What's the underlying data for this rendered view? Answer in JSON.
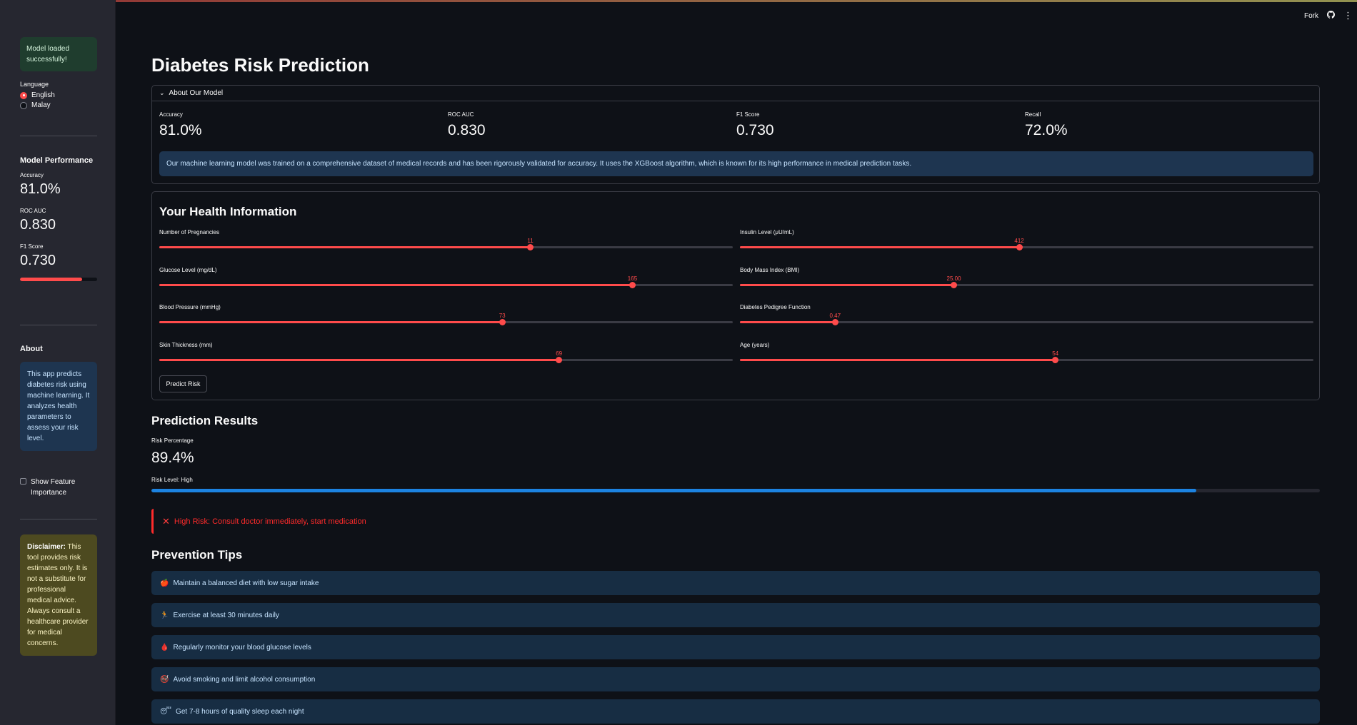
{
  "topbar": {
    "fork_label": "Fork",
    "github_icon": "github-icon",
    "menu_icon": "kebab-menu-icon"
  },
  "sidebar": {
    "model_status": "Model loaded successfully!",
    "language": {
      "label": "Language",
      "options": [
        "English",
        "Malay"
      ],
      "selected": "English"
    },
    "performance": {
      "title": "Model Performance",
      "accuracy_label": "Accuracy",
      "accuracy_value": "81.0%",
      "roc_label": "ROC AUC",
      "roc_value": "0.830",
      "f1_label": "F1 Score",
      "f1_value": "0.730",
      "progress": 0.81
    },
    "about": {
      "title": "About",
      "text": "This app predicts diabetes risk using machine learning. It analyzes health parameters to assess your risk level."
    },
    "feature_importance_label": "Show Feature Importance",
    "disclaimer": {
      "bold": "Disclaimer:",
      "text": " This tool provides risk estimates only. It is not a substitute for professional medical advice. Always consult a healthcare provider for medical concerns."
    }
  },
  "main": {
    "title": "Diabetes Risk Prediction",
    "about_model": {
      "expander_label": "About Our Model",
      "metrics": [
        {
          "label": "Accuracy",
          "value": "81.0%"
        },
        {
          "label": "ROC AUC",
          "value": "0.830"
        },
        {
          "label": "F1 Score",
          "value": "0.730"
        },
        {
          "label": "Recall",
          "value": "72.0%"
        }
      ],
      "info": "Our machine learning model was trained on a comprehensive dataset of medical records and has been rigorously validated for accuracy. It uses the XGBoost algorithm, which is known for its high performance in medical prediction tasks."
    },
    "health_form": {
      "title": "Your Health Information",
      "sliders": [
        {
          "label": "Number of Pregnancies",
          "value": "11",
          "fraction": 0.647
        },
        {
          "label": "Insulin Level (μU/mL)",
          "value": "412",
          "fraction": 0.487
        },
        {
          "label": "Glucose Level (mg/dL)",
          "value": "165",
          "fraction": 0.825
        },
        {
          "label": "Body Mass Index (BMI)",
          "value": "25.00",
          "fraction": 0.373
        },
        {
          "label": "Blood Pressure (mmHg)",
          "value": "73",
          "fraction": 0.598
        },
        {
          "label": "Diabetes Pedigree Function",
          "value": "0.47",
          "fraction": 0.166
        },
        {
          "label": "Skin Thickness (mm)",
          "value": "69",
          "fraction": 0.697
        },
        {
          "label": "Age (years)",
          "value": "54",
          "fraction": 0.55
        }
      ],
      "predict_button": "Predict Risk"
    },
    "results": {
      "title": "Prediction Results",
      "risk_label": "Risk Percentage",
      "risk_value": "89.4%",
      "risk_level": "Risk Level: High",
      "progress": 0.894,
      "alert": "High Risk: Consult doctor immediately, start medication"
    },
    "prevention": {
      "title": "Prevention Tips",
      "tips": [
        {
          "icon": "🍎",
          "text": "Maintain a balanced diet with low sugar intake"
        },
        {
          "icon": "🏃",
          "text": "Exercise at least 30 minutes daily"
        },
        {
          "icon": "🩸",
          "text": "Regularly monitor your blood glucose levels"
        },
        {
          "icon": "🚭",
          "text": "Avoid smoking and limit alcohol consumption"
        },
        {
          "icon": "😴",
          "text": "Get 7-8 hours of quality sleep each night"
        }
      ]
    }
  }
}
